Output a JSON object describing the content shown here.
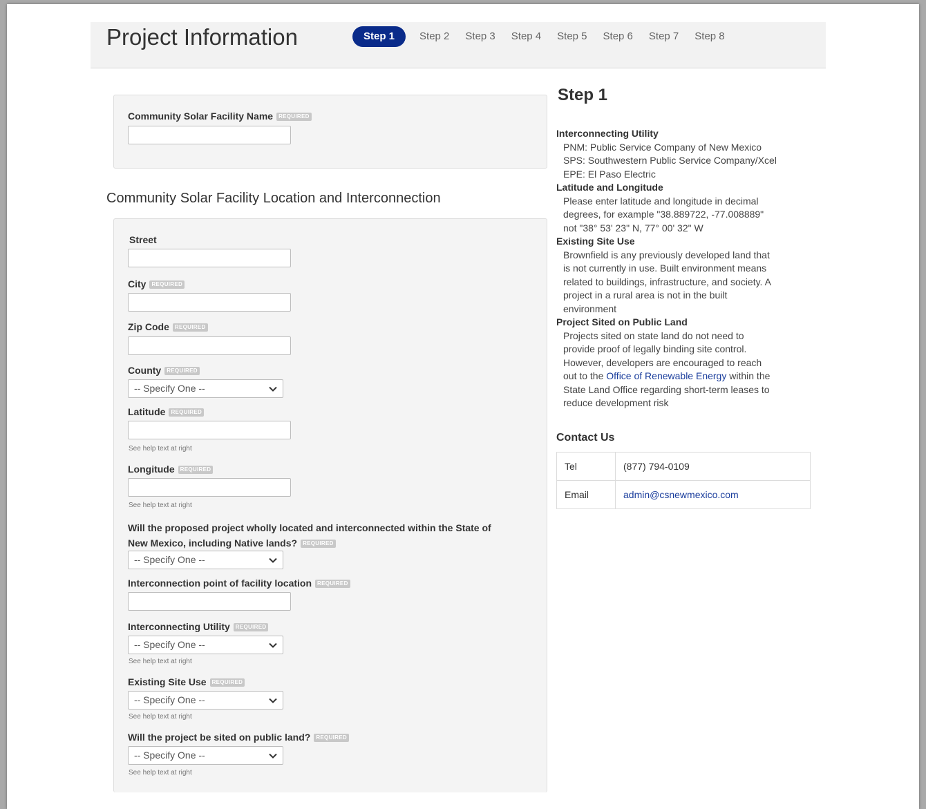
{
  "header": {
    "title": "Project Information",
    "steps": [
      "Step 1",
      "Step 2",
      "Step 3",
      "Step 4",
      "Step 5",
      "Step 6",
      "Step 7",
      "Step 8"
    ],
    "active_step": "Step 1"
  },
  "required_badge": "REQUIRED",
  "facility": {
    "name_label": "Community Solar Facility Name",
    "name_value": ""
  },
  "location": {
    "section_title": "Community Solar Facility Location and Interconnection",
    "street_label": "Street",
    "city_label": "City",
    "zip_label": "Zip Code",
    "county_label": "County",
    "county_value": "-- Specify One --",
    "latitude_label": "Latitude",
    "latitude_help": "See help text at right",
    "longitude_label": "Longitude",
    "longitude_help": "See help text at right",
    "within_nm_label_line1": "Will the proposed project wholly located and interconnected within the State of",
    "within_nm_label_line2": "New Mexico, including Native lands?",
    "within_nm_value": "-- Specify One --",
    "interconnection_point_label": "Interconnection point of facility location",
    "utility_label": "Interconnecting Utility",
    "utility_value": "-- Specify One --",
    "utility_help": "See help text at right",
    "site_use_label": "Existing Site Use",
    "site_use_value": "-- Specify One --",
    "site_use_help": "See help text at right",
    "public_land_label": "Will the project be sited on public land?",
    "public_land_value": "-- Specify One --",
    "public_land_help": "See help text at right"
  },
  "help": {
    "heading": "Step 1",
    "utility_title": "Interconnecting Utility",
    "utility_lines": [
      "PNM: Public Service Company of New Mexico",
      "SPS: Southwestern Public Service Company/Xcel",
      "EPE: El Paso Electric"
    ],
    "latlon_title": "Latitude and Longitude",
    "latlon_lines": [
      "Please enter latitude and longitude in decimal",
      "degrees, for example \"38.889722, -77.008889\"",
      "not \"38° 53' 23\" N, 77° 00' 32\" W"
    ],
    "site_use_title": "Existing Site Use",
    "site_use_lines": [
      "Brownfield is any previously developed land that",
      "is not currently in use. Built environment means",
      "related to buildings, infrastructure, and society. A",
      "project in a rural area is not in the built",
      "environment"
    ],
    "public_land_title": "Project Sited on Public Land",
    "public_land_lines": [
      "Projects sited on state land do not need to",
      "provide proof of legally binding site control.",
      "However, developers are encouraged to reach"
    ],
    "public_land_pre": "out to the ",
    "public_land_link": "Office of Renewable Energy",
    "public_land_post": " within the",
    "public_land_lines2": [
      "State Land Office regarding short-term leases to",
      "reduce development risk"
    ]
  },
  "contact": {
    "heading": "Contact Us",
    "tel_label": "Tel",
    "tel_value": "(877) 794-0109",
    "email_label": "Email",
    "email_value": "admin@csnewmexico.com"
  },
  "colors": {
    "active_step": "#0a2b8a",
    "link": "#1a3d9c",
    "panel": "#f4f4f4"
  }
}
